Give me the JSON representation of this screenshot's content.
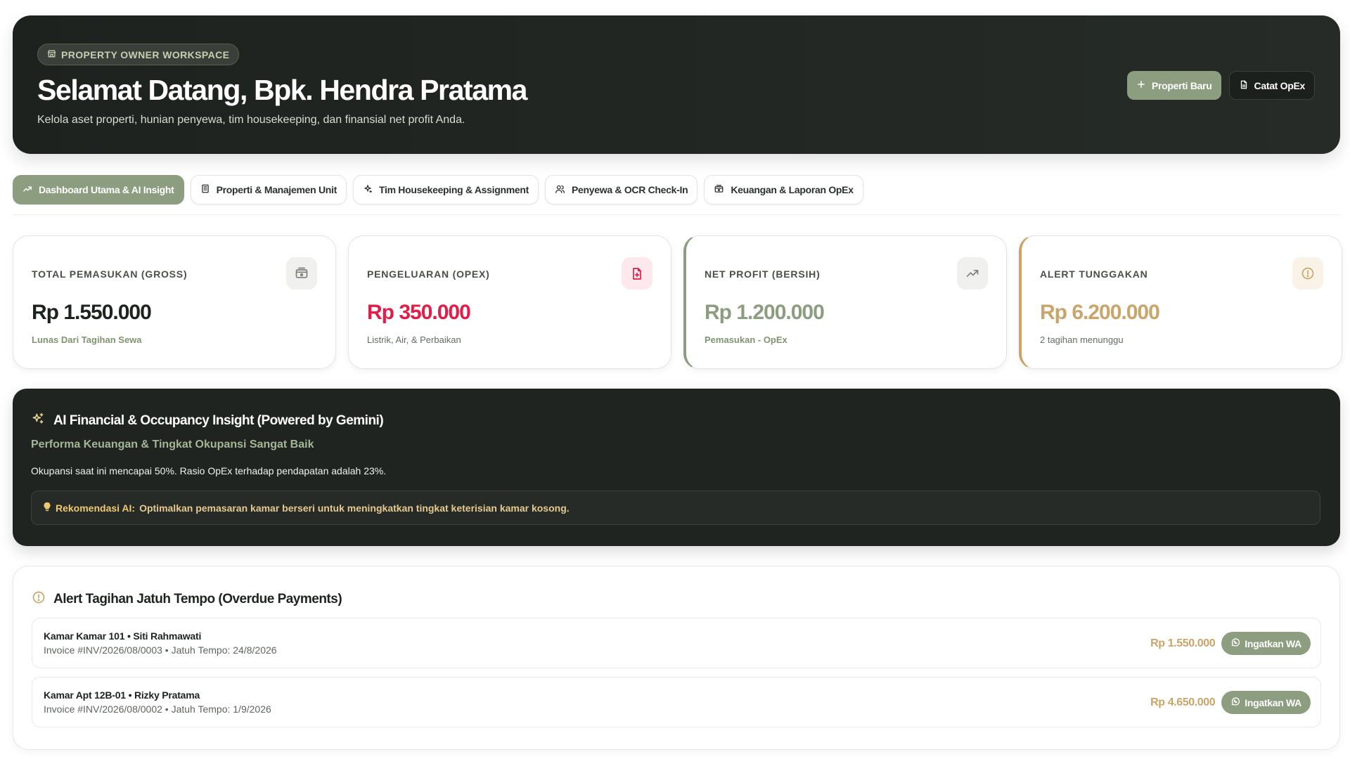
{
  "hero": {
    "badge": "PROPERTY OWNER WORKSPACE",
    "title": "Selamat Datang, Bpk. Hendra Pratama",
    "subtitle": "Kelola aset properti, hunian penyewa, tim housekeeping, dan finansial net profit Anda.",
    "btn_new_property": "Properti Baru",
    "btn_record_opex": "Catat OpEx"
  },
  "tabs": [
    {
      "label": "Dashboard Utama & AI Insight",
      "icon": "trending-up-icon",
      "active": true
    },
    {
      "label": "Properti & Manajemen Unit",
      "icon": "building-icon"
    },
    {
      "label": "Tim Housekeeping & Assignment",
      "icon": "sparkles-icon"
    },
    {
      "label": "Penyewa & OCR Check-In",
      "icon": "users-icon"
    },
    {
      "label": "Keuangan & Laporan OpEx",
      "icon": "wallet-icon"
    }
  ],
  "kpis": [
    {
      "label": "TOTAL PEMASUKAN (GROSS)",
      "value": "Rp 1.550.000",
      "note": "Lunas Dari Tagihan Sewa",
      "value_color": "#1f2320",
      "note_color": "#7f9471",
      "icon": "wallet-icon"
    },
    {
      "label": "PENGELUARAN (OPEX)",
      "value": "Rp 350.000",
      "note": "Listrik, Air, & Perbaikan",
      "value_color": "#e11d48",
      "note_color": "#666b66",
      "icon": "file-plus-icon"
    },
    {
      "label": "NET PROFIT (BERSIH)",
      "value": "Rp 1.200.000",
      "note": "Pemasukan - OpEx",
      "value_color": "#8c9d80",
      "note_color": "#7f9471",
      "icon": "trending-up-icon"
    },
    {
      "label": "ALERT TUNGGAKAN",
      "value": "Rp 6.200.000",
      "note": "2 tagihan menunggu",
      "value_color": "#c9a56b",
      "note_color": "#666b66",
      "icon": "alert-circle-icon"
    }
  ],
  "insight": {
    "title": "AI Financial & Occupancy Insight (Powered by Gemini)",
    "subtitle": "Performa Keuangan & Tingkat Okupansi Sangat Baik",
    "text": "Okupansi saat ini mencapai 50%. Rasio OpEx terhadap pendapatan adalah 23%.",
    "rec_label": "Rekomendasi AI:",
    "rec_text": "Optimalkan pemasaran kamar berseri untuk meningkatkan tingkat keterisian kamar kosong."
  },
  "overdue": {
    "title": "Alert Tagihan Jatuh Tempo (Overdue Payments)",
    "rows": [
      {
        "name": "Kamar Kamar 101 • Siti Rahmawati",
        "meta": "Invoice #INV/2026/08/0003 • Jatuh Tempo: 24/8/2026",
        "amount": "Rp 1.550.000",
        "button": "Ingatkan WA"
      },
      {
        "name": "Kamar Apt 12B-01 • Rizky Pratama",
        "meta": "Invoice #INV/2026/08/0002 • Jatuh Tempo: 1/9/2026",
        "amount": "Rp 4.650.000",
        "button": "Ingatkan WA"
      }
    ]
  },
  "colors": {
    "accent": "#8c9d80",
    "dark": "#1f2420",
    "gold": "#c9a56b",
    "danger": "#e11d48"
  }
}
